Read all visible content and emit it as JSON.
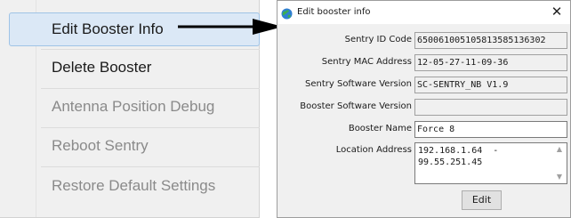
{
  "menu": {
    "items": [
      {
        "label": "Edit Booster Info",
        "enabled": true,
        "selected": true
      },
      {
        "label": "Delete Booster",
        "enabled": true,
        "selected": false
      },
      {
        "label": "Antenna Position Debug",
        "enabled": false,
        "selected": false
      },
      {
        "label": "Reboot Sentry",
        "enabled": false,
        "selected": false
      },
      {
        "label": "Restore Default Settings",
        "enabled": false,
        "selected": false
      }
    ]
  },
  "dialog": {
    "title": "Edit booster info",
    "close_glyph": "✕",
    "fields": {
      "sentry_id": {
        "label": "Sentry ID Code",
        "value": "65006100510581358513630​2"
      },
      "sentry_mac": {
        "label": "Sentry MAC Address",
        "value": "12-05-27-11-09-36"
      },
      "sentry_sw": {
        "label": "Sentry Software Version",
        "value": "SC-SENTRY_NB V1.9"
      },
      "booster_sw": {
        "label": "Booster Software Version",
        "value": ""
      },
      "booster_name": {
        "label": "Booster Name",
        "value": "Force 8"
      },
      "location": {
        "label": "Location Address",
        "value": "192.168.1.64  -\n99.55.251.45"
      }
    },
    "edit_label": "Edit",
    "scroll_up_glyph": "▲",
    "scroll_down_glyph": "▼"
  },
  "colors": {
    "arrow": "#000000",
    "selection_bg": "#dbe8f6",
    "selection_border": "#9fc3e6"
  },
  "icons": {
    "title": "globe-icon"
  }
}
